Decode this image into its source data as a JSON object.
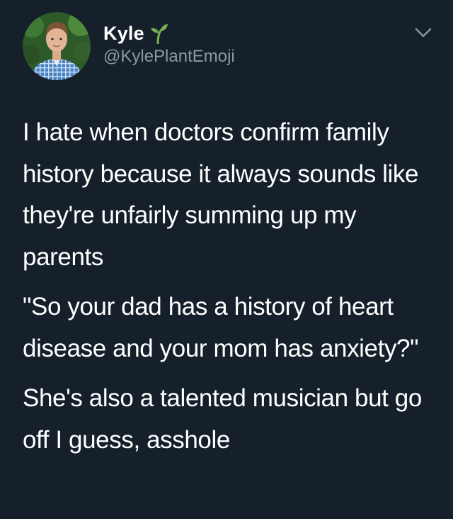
{
  "author": {
    "display_name": "Kyle",
    "name_emoji": "sprout-icon",
    "handle": "@KylePlantEmoji"
  },
  "menu": {
    "icon": "chevron-down-icon"
  },
  "tweet": {
    "paragraphs": [
      "I hate when doctors confirm family history because it always sounds like they're unfairly summing up my parents",
      "\"So your dad has a history of heart disease and your mom has anxiety?\"",
      "She's also a talented musician but go off I guess, asshole"
    ]
  },
  "colors": {
    "background": "#15202B",
    "primary_text": "#FFFFFF",
    "secondary_text": "#8899A6",
    "sprout_green": "#77B255"
  }
}
